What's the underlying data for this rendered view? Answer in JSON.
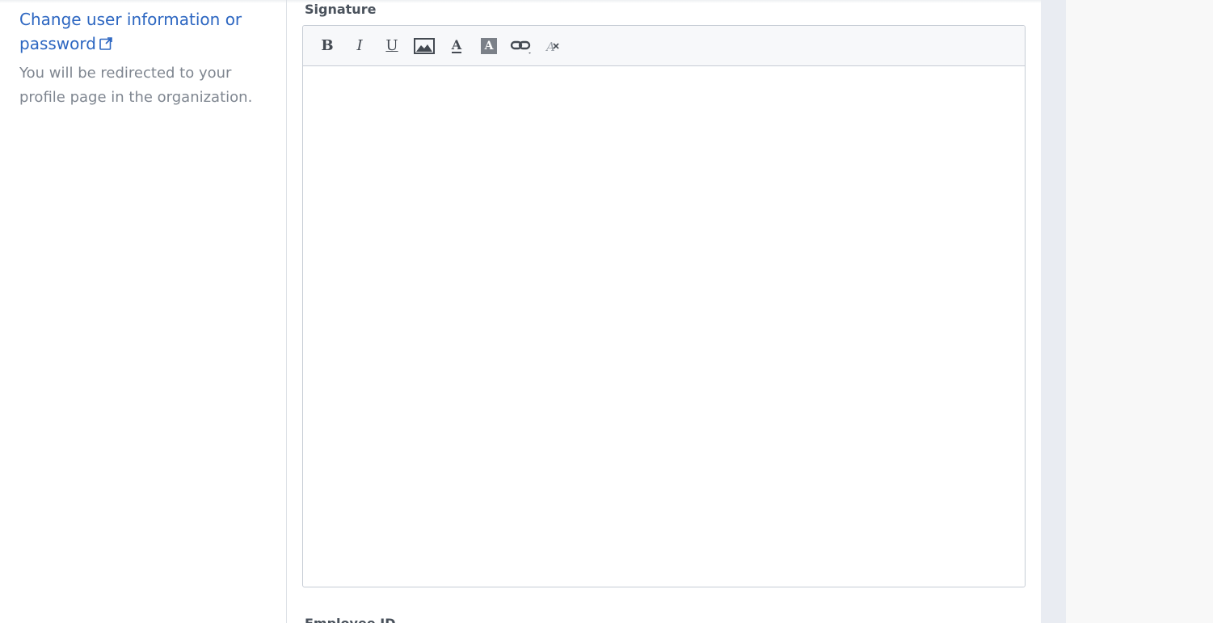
{
  "profile": {
    "link_text": "Change user information or password",
    "hint": "You will be redirected to your profile page in the organization."
  },
  "signature": {
    "label": "Signature",
    "toolbar": {
      "bold": "B",
      "italic": "I",
      "underline": "U",
      "font_color": "A",
      "background_color": "A"
    },
    "content": ""
  },
  "next_field": {
    "label": "Employee ID"
  },
  "colors": {
    "link": "#2c66c1",
    "hint_text": "#7f8690",
    "label_text": "#4a525c",
    "editor_border": "#c6ccd5",
    "gutter": "#e9ecf2"
  },
  "icons": {
    "external_link": "external-link-icon",
    "image": "image-icon",
    "link": "link-icon",
    "clear_format": "clear-format-icon"
  }
}
